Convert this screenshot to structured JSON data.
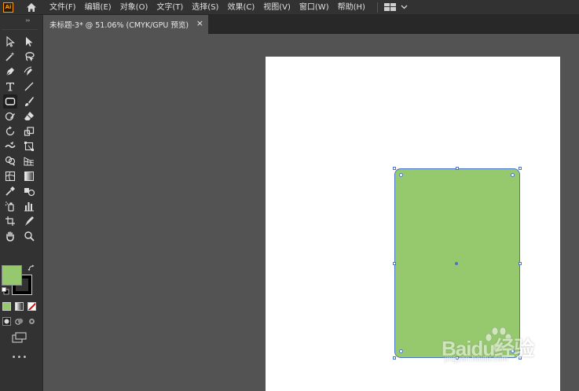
{
  "app": {
    "logo": "Ai"
  },
  "menu": [
    "文件(F)",
    "编辑(E)",
    "对象(O)",
    "文字(T)",
    "选择(S)",
    "效果(C)",
    "视图(V)",
    "窗口(W)",
    "帮助(H)"
  ],
  "document_tab": {
    "label": "未标题-3* @ 51.06% (CMYK/GPU 预览)",
    "close": "×"
  },
  "tools": [
    "selection-tool-icon",
    "direct-selection-tool-icon",
    "magic-wand-tool-icon",
    "lasso-tool-icon",
    "pen-tool-icon",
    "curvature-tool-icon",
    "type-tool-icon",
    "line-segment-tool-icon",
    "rounded-rectangle-tool-icon",
    "paintbrush-tool-icon",
    "shaper-tool-icon",
    "eraser-tool-icon",
    "rotate-tool-icon",
    "scale-tool-icon",
    "warp-tool-icon",
    "free-transform-tool-icon",
    "shape-builder-tool-icon",
    "perspective-grid-tool-icon",
    "mesh-tool-icon",
    "gradient-tool-icon",
    "eyedropper-tool-icon",
    "blend-tool-icon",
    "symbol-sprayer-tool-icon",
    "column-graph-tool-icon",
    "artboard-tool-icon",
    "slice-tool-icon",
    "hand-tool-icon",
    "zoom-tool-icon"
  ],
  "colors": {
    "fill": "#96c96e",
    "stroke": "#000000",
    "selection": "#4a74c9",
    "chrome_dark": "#323232",
    "canvas": "#535353"
  },
  "watermark": {
    "brand": "Baidu经验",
    "url": "jingyan.baidu.com"
  },
  "more_tools": "•••"
}
